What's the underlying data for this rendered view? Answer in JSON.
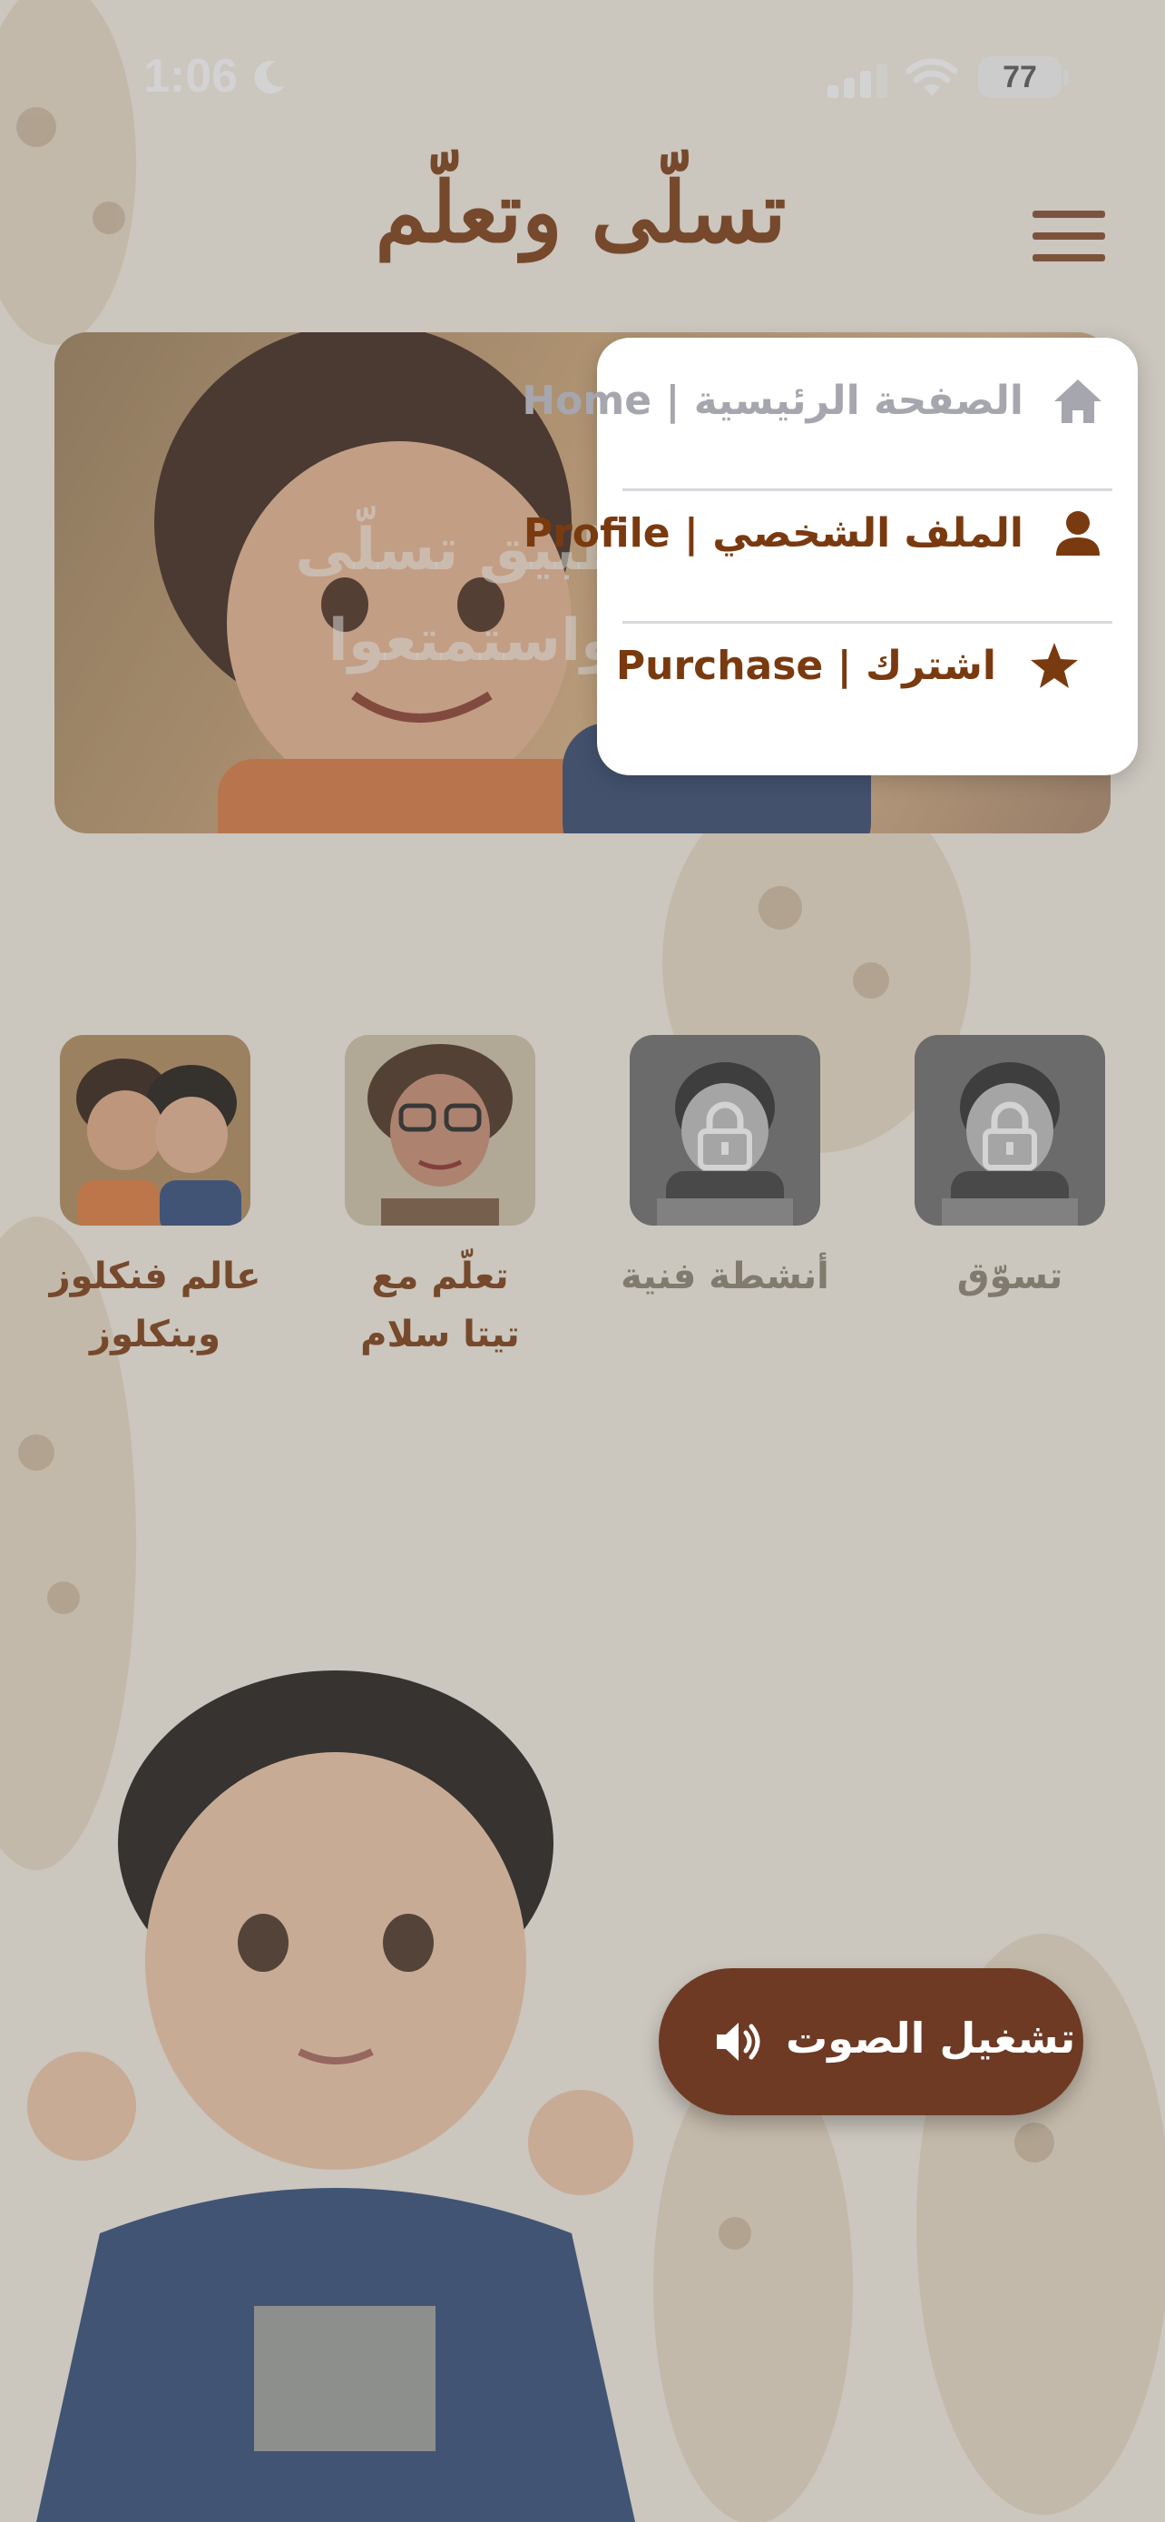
{
  "status_bar": {
    "time": "1:06",
    "battery": "77"
  },
  "header": {
    "title": "تسلّى وتعلّم"
  },
  "banner": {
    "text_line1": "تطبيق تسلّى",
    "text_line2": "ا واستمتعوا"
  },
  "menu": {
    "items": [
      {
        "label": "Home | الصفحة الرئيسية",
        "icon": "home-icon",
        "color": "#a6a6ae"
      },
      {
        "label": "Profile | الملف الشخصي",
        "icon": "person-icon",
        "color": "#7a3a10"
      },
      {
        "label": "Purchase | اشترك",
        "icon": "star-icon",
        "color": "#7a3a10"
      }
    ]
  },
  "cards": [
    {
      "label": "تسوّق",
      "locked": true
    },
    {
      "label": "أنشطة فنية",
      "locked": true
    },
    {
      "label_line1": "تعلّم مع",
      "label_line2": "تيتا سلام",
      "locked": false
    },
    {
      "label_line1": "عالم فنكلوز",
      "label_line2": "وبنكلوز",
      "locked": false
    }
  ],
  "play_button": {
    "label": "تشغيل الصوت",
    "icon": "speaker-icon"
  },
  "colors": {
    "brand_brown": "#7a3a10",
    "button_brown": "#6e3a24",
    "locked_label": "#8a8070"
  }
}
